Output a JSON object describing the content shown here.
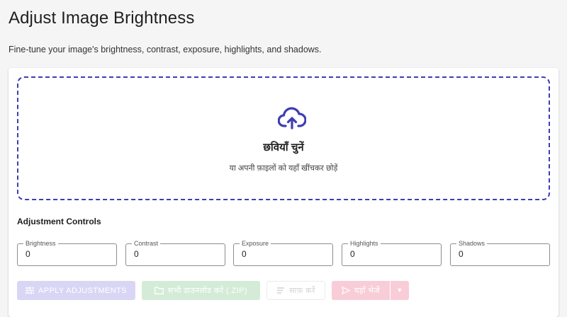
{
  "header": {
    "title": "Adjust Image Brightness",
    "subtitle": "Fine-tune your image's brightness, contrast, exposure, highlights, and shadows."
  },
  "dropzone": {
    "title": "छवियाँ चुनें",
    "subtitle": "या अपनी फ़ाइलों को यहाँ खींचकर छोड़ें",
    "icon": "cloud-upload-icon",
    "border_color": "#3f3db0"
  },
  "controls": {
    "section_title": "Adjustment Controls",
    "fields": [
      {
        "label": "Brightness",
        "value": "0"
      },
      {
        "label": "Contrast",
        "value": "0"
      },
      {
        "label": "Exposure",
        "value": "0"
      },
      {
        "label": "Highlights",
        "value": "0"
      },
      {
        "label": "Shadows",
        "value": "0"
      }
    ]
  },
  "actions": {
    "apply_label": "APPLY ADJUSTMENTS",
    "download_label": "सभी डाउनलोड करें (.ZIP)",
    "clear_label": "साफ़ करें",
    "send_label": "यहाँ भेजें",
    "apply_color": "#d9d6f5",
    "download_color": "#d4ecd7",
    "send_color": "#f8cdd8"
  }
}
